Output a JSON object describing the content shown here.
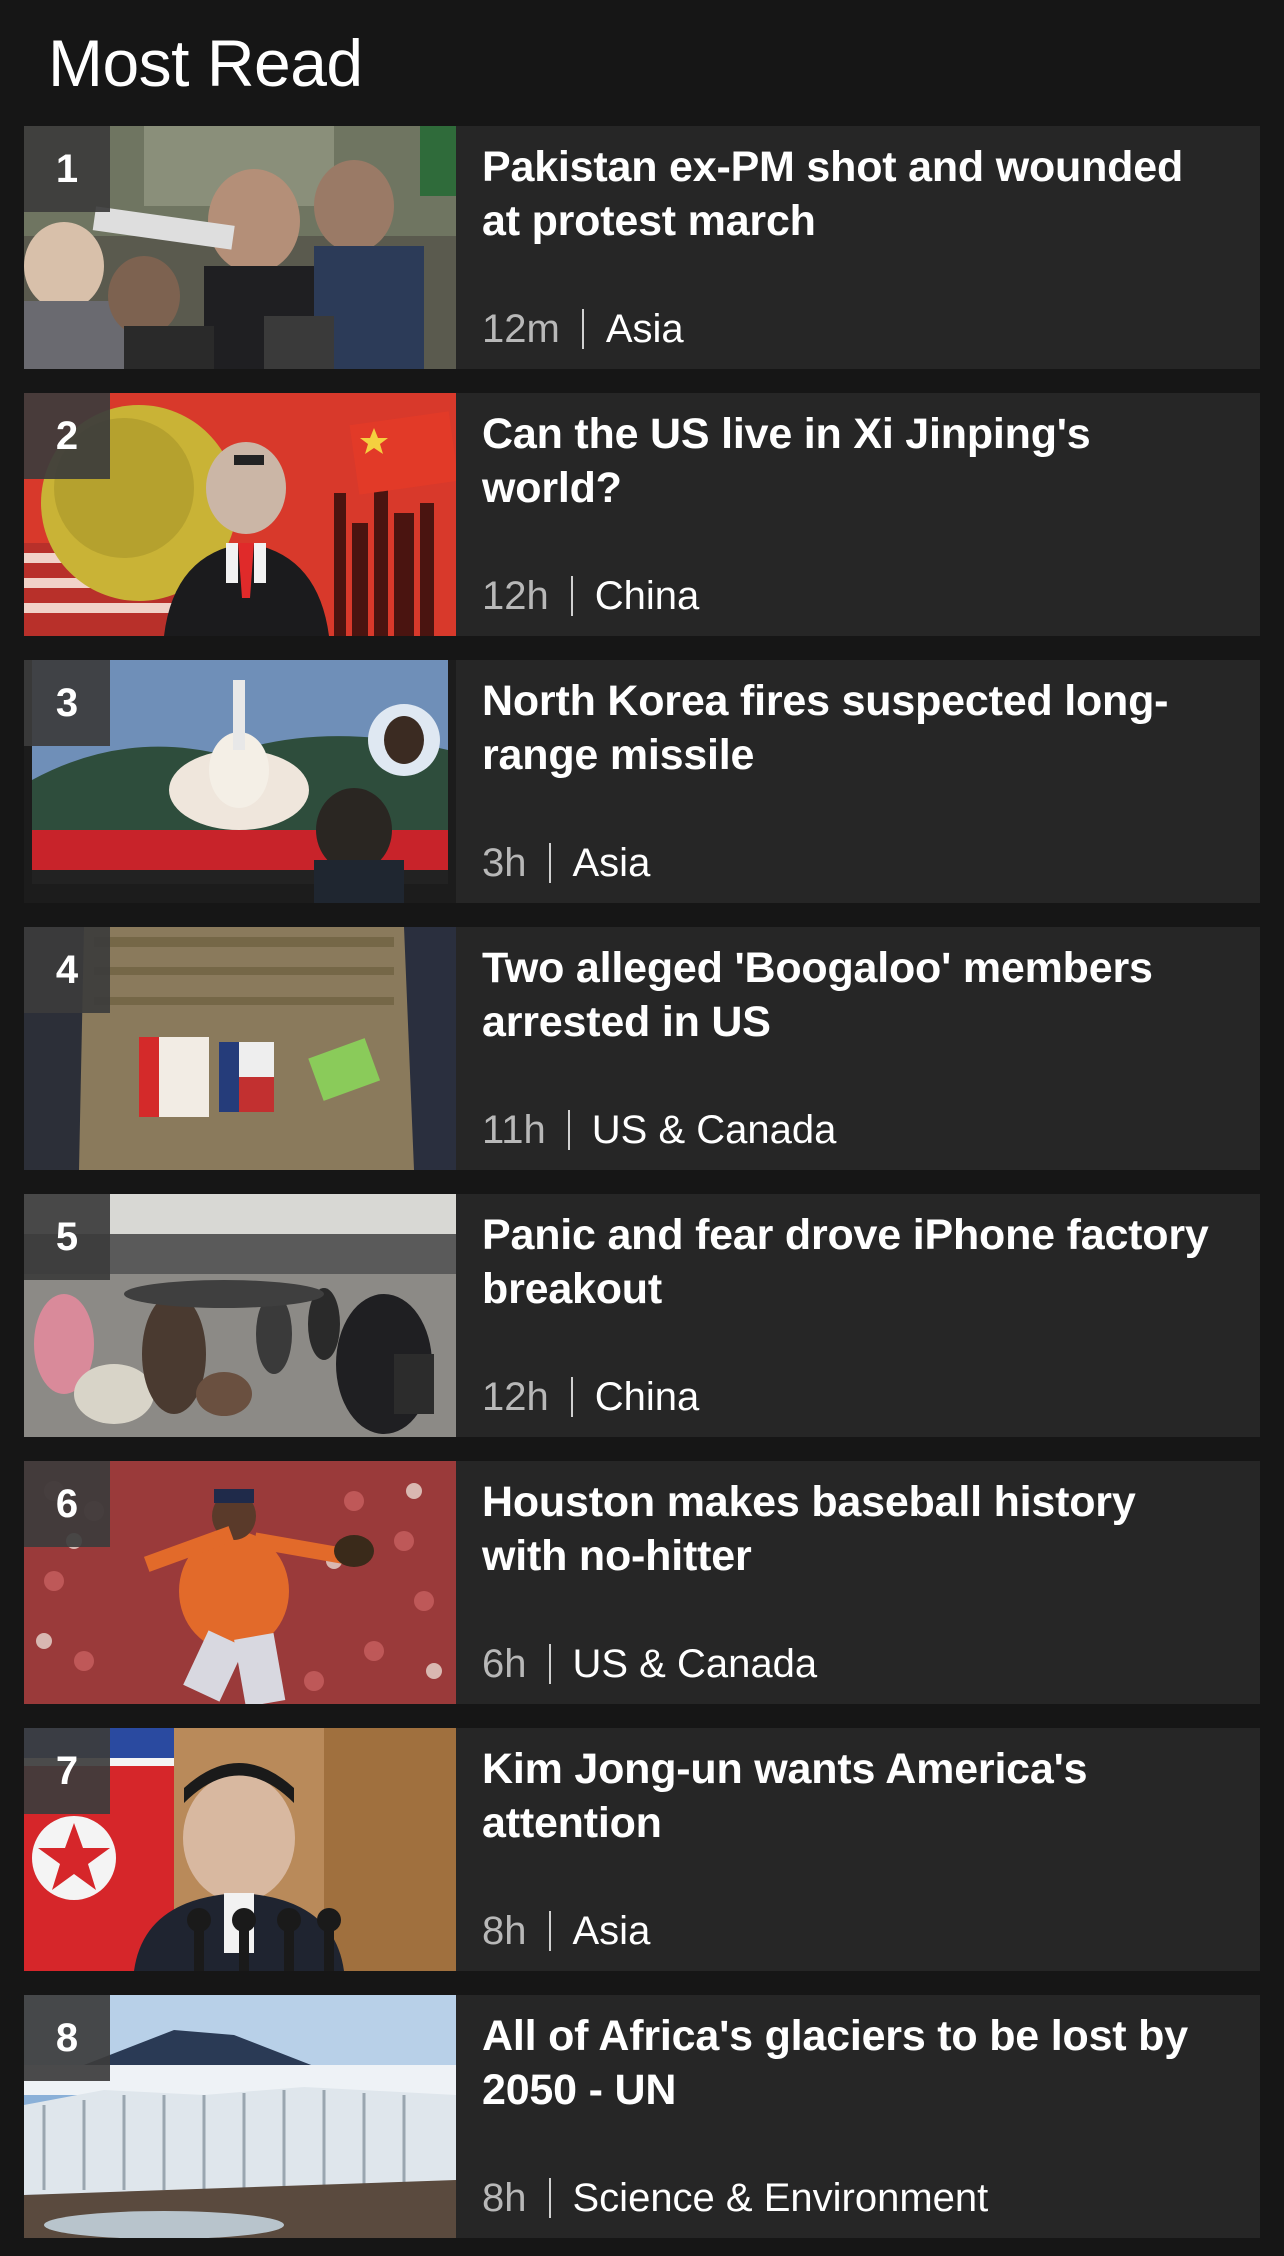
{
  "section": {
    "title": "Most Read"
  },
  "items": [
    {
      "rank": "1",
      "headline": "Pakistan ex-PM shot and wounded at protest march",
      "time": "12m",
      "topic": "Asia"
    },
    {
      "rank": "2",
      "headline": "Can the US live in Xi Jinping's world?",
      "time": "12h",
      "topic": "China"
    },
    {
      "rank": "3",
      "headline": "North Korea fires suspected long-range missile",
      "time": "3h",
      "topic": "Asia"
    },
    {
      "rank": "4",
      "headline": "Two alleged 'Boogaloo' members arrested in US",
      "time": "11h",
      "topic": "US & Canada"
    },
    {
      "rank": "5",
      "headline": "Panic and fear drove iPhone factory breakout",
      "time": "12h",
      "topic": "China"
    },
    {
      "rank": "6",
      "headline": "Houston makes baseball history with no-hitter",
      "time": "6h",
      "topic": "US & Canada"
    },
    {
      "rank": "7",
      "headline": "Kim Jong-un wants America's attention",
      "time": "8h",
      "topic": "Asia"
    },
    {
      "rank": "8",
      "headline": "All of Africa's glaciers to be lost by 2050 - UN",
      "time": "8h",
      "topic": "Science & Environment"
    }
  ],
  "colors": {
    "background": "#161616",
    "card": "#262626",
    "rank_badge": "#3c3c3c",
    "meta_time": "#b8b8b8"
  }
}
